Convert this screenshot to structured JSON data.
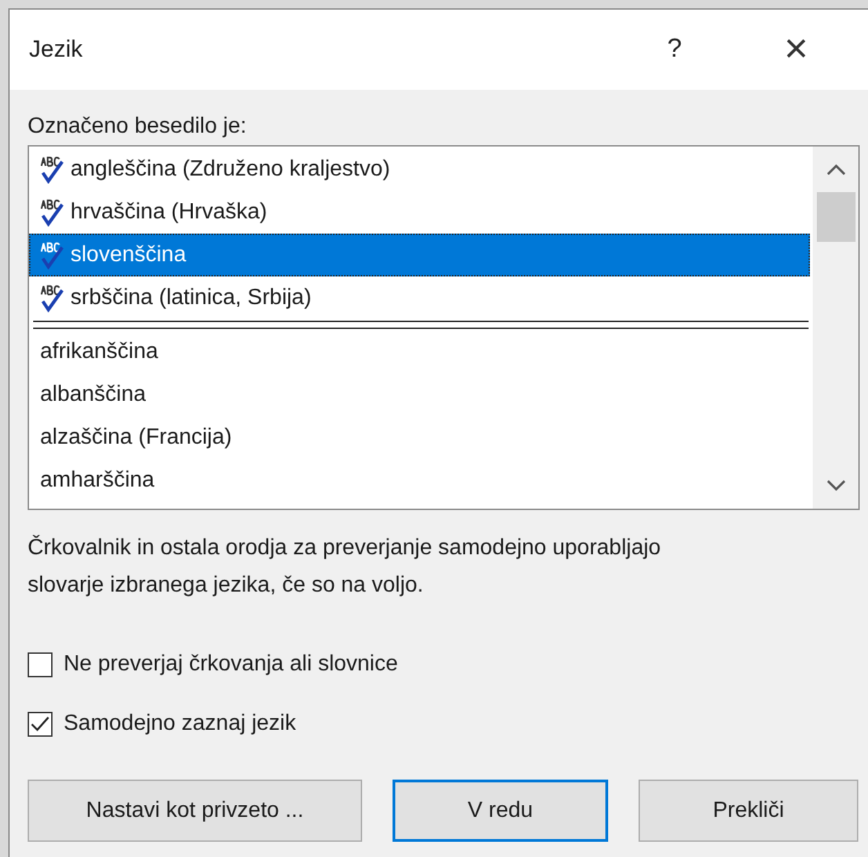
{
  "window": {
    "title": "Jezik",
    "help": "?",
    "close": "×"
  },
  "list_label": "Označeno besedilo je:",
  "languages": [
    {
      "label": "angleščina (Združeno kraljestvo)",
      "kind": "proofing",
      "selected": false
    },
    {
      "label": "hrvaščina (Hrvaška)",
      "kind": "proofing",
      "selected": false
    },
    {
      "label": "slovenščina",
      "kind": "proofing",
      "selected": true
    },
    {
      "label": "srbščina (latinica, Srbija)",
      "kind": "proofing",
      "selected": false
    },
    {
      "label": "afrikanščina",
      "kind": "plain",
      "selected": false
    },
    {
      "label": "albanščina",
      "kind": "plain",
      "selected": false
    },
    {
      "label": "alzaščina (Francija)",
      "kind": "plain",
      "selected": false
    },
    {
      "label": "amharščina",
      "kind": "plain",
      "selected": false
    }
  ],
  "description": "Črkovalnik in ostala orodja za preverjanje samodejno uporabljajo slovarje izbranega jezika, če so na voljo.",
  "options": [
    {
      "label": "Ne preverjaj črkovanja ali slovnice",
      "checked": false
    },
    {
      "label": "Samodejno zaznaj jezik",
      "checked": true
    }
  ],
  "buttons": [
    {
      "label": "Nastavi kot privzeto ...",
      "kind": "normal"
    },
    {
      "label": "V redu",
      "kind": "default"
    },
    {
      "label": "Prekliči",
      "kind": "normal"
    }
  ]
}
